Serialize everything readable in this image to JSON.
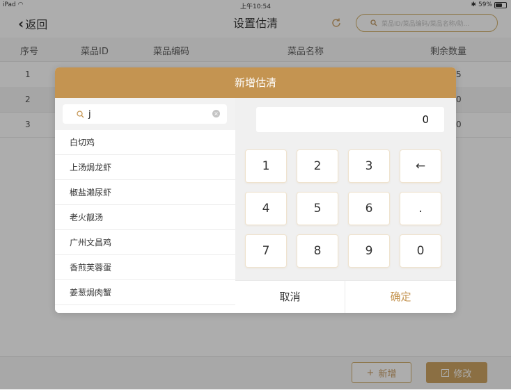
{
  "status_bar": {
    "device": "iPad",
    "time": "上午10:54",
    "battery": "59%",
    "battery_level": 0.59
  },
  "header": {
    "back_label": "返回",
    "title": "设置估清",
    "search_placeholder": "菜品ID/菜品编码/菜品名称/助..."
  },
  "table": {
    "columns": [
      "序号",
      "菜品ID",
      "菜品编码",
      "菜品名称",
      "剩余数量"
    ],
    "rows": [
      {
        "index": "1",
        "remaining_partial": "5"
      },
      {
        "index": "2",
        "remaining_partial": "0"
      },
      {
        "index": "3",
        "remaining_partial": "0"
      }
    ]
  },
  "bottom_bar": {
    "add_label": "新增",
    "edit_label": "修改"
  },
  "modal": {
    "title": "新增估清",
    "filter_value": "j",
    "dishes": [
      "白切鸡",
      "上汤焗龙虾",
      "椒盐濑尿虾",
      "老火靓汤",
      "广州文昌鸡",
      "香煎芙蓉蛋",
      "姜葱焗肉蟹"
    ],
    "quantity": "0",
    "keys": [
      "1",
      "2",
      "3",
      "←",
      "4",
      "5",
      "6",
      ".",
      "7",
      "8",
      "9",
      "0"
    ],
    "cancel_label": "取消",
    "confirm_label": "确定"
  },
  "colors": {
    "accent": "#c49451",
    "overlay": "rgba(60,60,60,0.42)"
  }
}
